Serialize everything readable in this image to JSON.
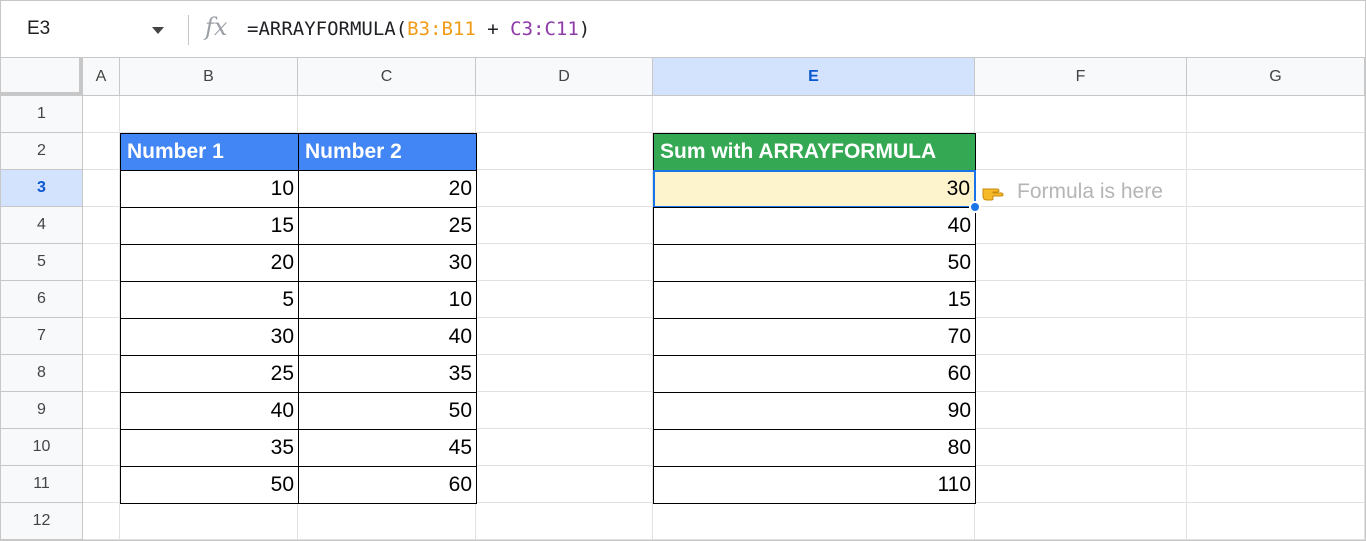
{
  "formula_bar": {
    "cell_ref": "E3",
    "fx_label": "fx",
    "formula_prefix": "=ARRAYFORMULA(",
    "range_b": "B3:B11",
    "operator": " + ",
    "range_c": "C3:C11",
    "formula_suffix": ")"
  },
  "columns": [
    "A",
    "B",
    "C",
    "D",
    "E",
    "F",
    "G"
  ],
  "selected_column": "E",
  "rows": [
    "1",
    "2",
    "3",
    "4",
    "5",
    "6",
    "7",
    "8",
    "9",
    "10",
    "11",
    "12"
  ],
  "selected_row": "3",
  "table1": {
    "headers": [
      "Number 1",
      "Number 2"
    ],
    "rows": [
      [
        "10",
        "20"
      ],
      [
        "15",
        "25"
      ],
      [
        "20",
        "30"
      ],
      [
        "5",
        "10"
      ],
      [
        "30",
        "40"
      ],
      [
        "25",
        "35"
      ],
      [
        "40",
        "50"
      ],
      [
        "35",
        "45"
      ],
      [
        "50",
        "60"
      ]
    ]
  },
  "table2": {
    "header": "Sum with ARRAYFORMULA",
    "values": [
      "30",
      "40",
      "50",
      "15",
      "70",
      "60",
      "90",
      "80",
      "110"
    ]
  },
  "annotation": {
    "icon": "pointing-hand-icon",
    "text": "Formula is here"
  },
  "colors": {
    "header_blue": "#4285f4",
    "header_green": "#34a853",
    "active_fill": "#fdf3cc",
    "selection_blue": "#1a73e8",
    "range_b": "#f19c16",
    "range_c": "#8e3ba8"
  }
}
